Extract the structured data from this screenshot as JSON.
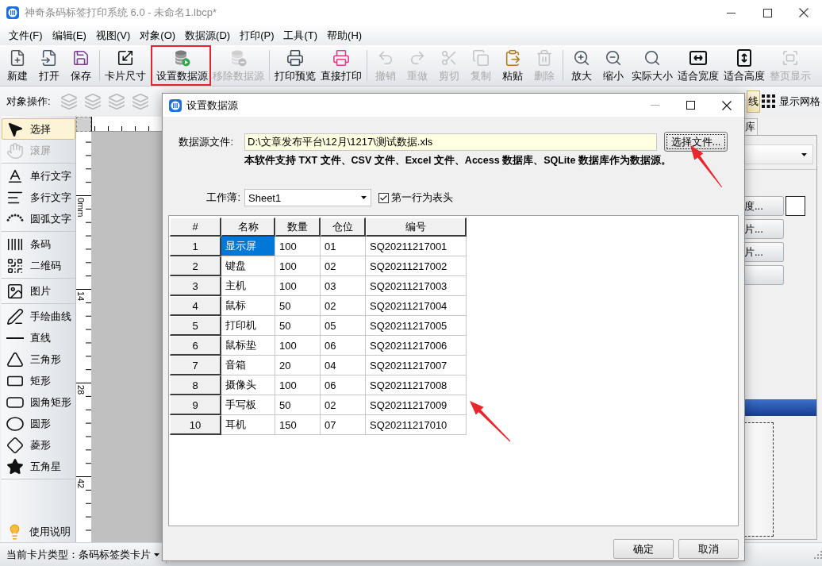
{
  "window": {
    "title": "神奇条码标签打印系统 6.0 - 未命名1.lbcp*"
  },
  "menu": [
    "文件(F)",
    "编辑(E)",
    "视图(V)",
    "对象(O)",
    "数据源(D)",
    "打印(P)",
    "工具(T)",
    "帮助(H)"
  ],
  "toolbar": [
    [
      {
        "label": "新建",
        "disabled": false
      },
      {
        "label": "打开",
        "disabled": false
      },
      {
        "label": "保存",
        "disabled": false
      }
    ],
    [
      {
        "label": "卡片尺寸",
        "disabled": false
      }
    ],
    [
      {
        "label": "设置数据源",
        "disabled": false
      },
      {
        "label": "移除数据源",
        "disabled": true
      }
    ],
    [
      {
        "label": "打印预览",
        "disabled": false
      },
      {
        "label": "直接打印",
        "disabled": false
      }
    ],
    [
      {
        "label": "撤销",
        "disabled": true
      },
      {
        "label": "重做",
        "disabled": true
      },
      {
        "label": "剪切",
        "disabled": true
      },
      {
        "label": "复制",
        "disabled": true
      },
      {
        "label": "粘贴",
        "disabled": false
      },
      {
        "label": "删除",
        "disabled": true
      }
    ],
    [
      {
        "label": "放大",
        "disabled": false
      },
      {
        "label": "缩小",
        "disabled": false
      },
      {
        "label": "实际大小",
        "disabled": false
      },
      {
        "label": "适合宽度",
        "disabled": false
      },
      {
        "label": "适合高度",
        "disabled": false
      },
      {
        "label": "整页显示",
        "disabled": true
      }
    ]
  ],
  "object_bar": {
    "label": "对象操作:",
    "toggle": {
      "label": "线",
      "on": true
    },
    "grid_label": "显示网格"
  },
  "tools": [
    [
      {
        "label": "选择",
        "selected": true,
        "disabled": false
      },
      {
        "label": "滚屏",
        "selected": false,
        "disabled": true
      }
    ],
    [
      {
        "label": "单行文字",
        "selected": false,
        "disabled": false
      },
      {
        "label": "多行文字",
        "selected": false,
        "disabled": false
      },
      {
        "label": "圆弧文字",
        "selected": false,
        "disabled": false
      }
    ],
    [
      {
        "label": "条码",
        "selected": false,
        "disabled": false
      },
      {
        "label": "二维码",
        "selected": false,
        "disabled": false
      }
    ],
    [
      {
        "label": "图片",
        "selected": false,
        "disabled": false
      }
    ],
    [
      {
        "label": "手绘曲线",
        "selected": false,
        "disabled": false
      },
      {
        "label": "直线",
        "selected": false,
        "disabled": false
      },
      {
        "label": "三角形",
        "selected": false,
        "disabled": false
      },
      {
        "label": "矩形",
        "selected": false,
        "disabled": false
      },
      {
        "label": "圆角矩形",
        "selected": false,
        "disabled": false
      },
      {
        "label": "圆形",
        "selected": false,
        "disabled": false
      },
      {
        "label": "菱形",
        "selected": false,
        "disabled": false
      },
      {
        "label": "五角星",
        "selected": false,
        "disabled": false
      }
    ]
  ],
  "help": {
    "label": "使用说明"
  },
  "ruler": {
    "labels": [
      "0mm",
      "14",
      "28",
      "42"
    ]
  },
  "right_panel": {
    "tab": "库",
    "buttons": [
      "度...",
      "片...",
      "片..."
    ]
  },
  "status_bar": {
    "card_type": "当前卡片类型：条码标签类卡片"
  },
  "dialog": {
    "title": "设置数据源",
    "file_label": "数据源文件:",
    "file_path": "D:\\文章发布平台\\12月\\1217\\测试数据.xls",
    "browse_button": "选择文件...",
    "note": "本软件支持 TXT 文件、CSV 文件、Excel 文件、Access 数据库、SQLite 数据库作为数据源。",
    "sheet_label": "工作薄:",
    "sheet": "Sheet1",
    "header_row": {
      "label": "第一行为表头",
      "checked": true
    },
    "table": {
      "columns": [
        "#",
        "名称",
        "数量",
        "仓位",
        "编号"
      ],
      "rows": [
        {
          "number": "1",
          "cells": [
            {
              "text": "显示屏",
              "selected": true
            },
            {
              "text": "100",
              "selected": false
            },
            {
              "text": "01",
              "selected": false
            },
            {
              "text": "SQ20211217001",
              "selected": false
            }
          ]
        },
        {
          "number": "2",
          "cells": [
            {
              "text": "键盘",
              "selected": false
            },
            {
              "text": "100",
              "selected": false
            },
            {
              "text": "02",
              "selected": false
            },
            {
              "text": "SQ20211217002",
              "selected": false
            }
          ]
        },
        {
          "number": "3",
          "cells": [
            {
              "text": "主机",
              "selected": false
            },
            {
              "text": "100",
              "selected": false
            },
            {
              "text": "03",
              "selected": false
            },
            {
              "text": "SQ20211217003",
              "selected": false
            }
          ]
        },
        {
          "number": "4",
          "cells": [
            {
              "text": "鼠标",
              "selected": false
            },
            {
              "text": "50",
              "selected": false
            },
            {
              "text": "02",
              "selected": false
            },
            {
              "text": "SQ20211217004",
              "selected": false
            }
          ]
        },
        {
          "number": "5",
          "cells": [
            {
              "text": "打印机",
              "selected": false
            },
            {
              "text": "50",
              "selected": false
            },
            {
              "text": "05",
              "selected": false
            },
            {
              "text": "SQ20211217005",
              "selected": false
            }
          ]
        },
        {
          "number": "6",
          "cells": [
            {
              "text": "鼠标垫",
              "selected": false
            },
            {
              "text": "100",
              "selected": false
            },
            {
              "text": "06",
              "selected": false
            },
            {
              "text": "SQ20211217006",
              "selected": false
            }
          ]
        },
        {
          "number": "7",
          "cells": [
            {
              "text": "音箱",
              "selected": false
            },
            {
              "text": "20",
              "selected": false
            },
            {
              "text": "04",
              "selected": false
            },
            {
              "text": "SQ20211217007",
              "selected": false
            }
          ]
        },
        {
          "number": "8",
          "cells": [
            {
              "text": "摄像头",
              "selected": false
            },
            {
              "text": "100",
              "selected": false
            },
            {
              "text": "06",
              "selected": false
            },
            {
              "text": "SQ20211217008",
              "selected": false
            }
          ]
        },
        {
          "number": "9",
          "cells": [
            {
              "text": "手写板",
              "selected": false
            },
            {
              "text": "50",
              "selected": false
            },
            {
              "text": "02",
              "selected": false
            },
            {
              "text": "SQ20211217009",
              "selected": false
            }
          ]
        },
        {
          "number": "10",
          "cells": [
            {
              "text": "耳机",
              "selected": false
            },
            {
              "text": "150",
              "selected": false
            },
            {
              "text": "07",
              "selected": false
            },
            {
              "text": "SQ20211217010",
              "selected": false
            }
          ]
        }
      ]
    },
    "buttons": [
      "确定",
      "取消"
    ]
  }
}
